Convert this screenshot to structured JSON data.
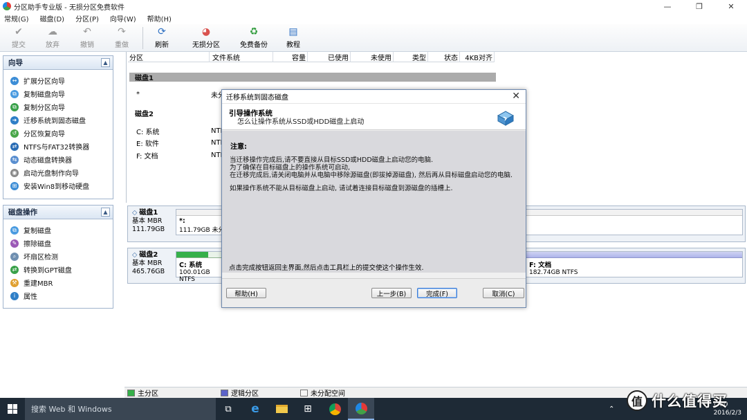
{
  "window": {
    "title": "分区助手专业版 - 无损分区免费软件",
    "controls": [
      "—",
      "❐",
      "✕"
    ]
  },
  "menu": [
    "常规(G)",
    "磁盘(D)",
    "分区(P)",
    "向导(W)",
    "帮助(H)"
  ],
  "toolbar": {
    "submit": "提交",
    "discard": "放弃",
    "undo": "撤销",
    "redo": "重做",
    "refresh": "刷新",
    "lossless": "无损分区",
    "backup": "免费备份",
    "tutorial": "教程"
  },
  "wizard_panel": {
    "title": "向导",
    "items": [
      "扩展分区向导",
      "复制磁盘向导",
      "复制分区向导",
      "迁移系统到固态磁盘",
      "分区恢复向导",
      "NTFS与FAT32转换器",
      "动态磁盘转换器",
      "启动光盘制作向导",
      "安装Win8到移动硬盘"
    ]
  },
  "disk_ops_panel": {
    "title": "磁盘操作",
    "items": [
      "复制磁盘",
      "擦除磁盘",
      "坏扇区检测",
      "转换到GPT磁盘",
      "重建MBR",
      "属性"
    ]
  },
  "columns": [
    "分区",
    "文件系统",
    "容量",
    "已使用",
    "未使用",
    "类型",
    "状态",
    "4KB对齐"
  ],
  "partition_list": {
    "disk1": "磁盘1",
    "disk1_row": {
      "name": "*",
      "fs": "未分"
    },
    "disk2": "磁盘2",
    "disk2_rows": [
      {
        "name": "C: 系统",
        "fs": "NTFS"
      },
      {
        "name": "E: 软件",
        "fs": "NTFS"
      },
      {
        "name": "F: 文档",
        "fs": "NTFS"
      }
    ]
  },
  "disk_map": {
    "disk1": {
      "name": "磁盘1",
      "type": "基本 MBR",
      "size": "111.79GB",
      "seg_title": "*:",
      "seg_info": "111.79GB 未分配"
    },
    "disk2": {
      "name": "磁盘2",
      "type": "基本 MBR",
      "size": "465.76GB",
      "c_title": "C: 系统",
      "c_info": "100.01GB NTFS",
      "f_title": "F: 文档",
      "f_info": "182.74GB NTFS"
    }
  },
  "legend": {
    "primary": "主分区",
    "logical": "逻辑分区",
    "unallocated": "未分配空间"
  },
  "dialog": {
    "title": "迁移系统到固态磁盘",
    "heading": "引导操作系统",
    "subheading": "怎么让操作系统从SSD或HDD磁盘上启动",
    "note_title": "注意:",
    "notes": [
      "当迁移操作完成后,请不要直接从目标SSD或HDD磁盘上启动您的电脑.",
      "为了确保在目标磁盘上的操作系统可启动,",
      "在迁移完成后,请关闭电脑并从电脑中移除源磁盘(即拔掉源磁盘), 然后再从目标磁盘启动您的电脑.",
      "如果操作系统不能从目标磁盘上启动, 请试着连接目标磁盘到源磁盘的插槽上."
    ],
    "footer": "点击完成按钮返回主界面,然后点击工具栏上的提交使这个操作生效.",
    "buttons": {
      "help": "帮助(H)",
      "back": "上一步(B)",
      "finish": "完成(F)",
      "cancel": "取消(C)"
    }
  },
  "taskbar": {
    "search_placeholder": "搜索 Web 和 Windows",
    "time": "1:00",
    "date": "2016/2/3",
    "watermark": "什么值得买",
    "watermark_badge": "值"
  }
}
